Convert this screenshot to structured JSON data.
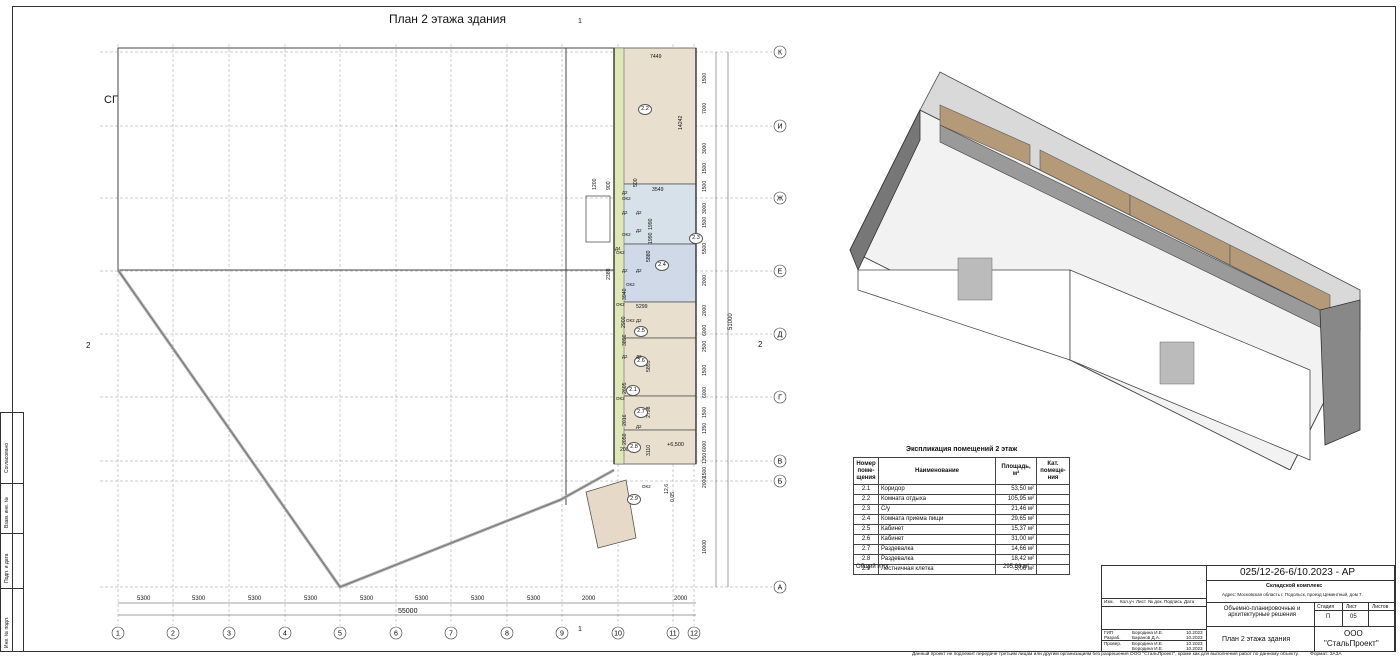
{
  "plan": {
    "title": "План 2 этажа здания",
    "section_marks": {
      "top": "1",
      "bottom": "1",
      "left": "2",
      "right": "2"
    },
    "axes_x": [
      "1",
      "2",
      "3",
      "4",
      "5",
      "6",
      "7",
      "8",
      "9",
      "10",
      "11",
      "12"
    ],
    "axes_y": [
      "К",
      "И",
      "Ж",
      "Е",
      "Д",
      "Г",
      "В",
      "Б",
      "А"
    ],
    "bottom_dims": [
      "5300",
      "5300",
      "5300",
      "5300",
      "5300",
      "5300",
      "5300",
      "5300",
      "2000",
      "2000"
    ],
    "overall_width": "55000",
    "overall_height": "51000",
    "right_dims": [
      "1500",
      "7000",
      "3000",
      "1500",
      "1500",
      "3000",
      "1500",
      "5500",
      "2000",
      "2000",
      "6000",
      "2500",
      "1500",
      "6000",
      "1500",
      "1350",
      "6000",
      "1350",
      "1500",
      "2000",
      "10000"
    ],
    "room_dims": [
      "7449",
      "14242",
      "3549",
      "5880",
      "5299",
      "2900",
      "5855",
      "2798",
      "3110",
      "2000",
      "3940",
      "3890",
      "2605",
      "2016",
      "2050",
      "2380",
      "900",
      "1200",
      "500",
      "1990",
      "1990",
      "12,6",
      "0,05"
    ],
    "room_tags": [
      "2.2",
      "2.3",
      "2.4",
      "2.5",
      "2.6",
      "2.1",
      "2.7",
      "2.8",
      "2.9"
    ],
    "door_tags": [
      "Д2",
      "Д2",
      "Д2",
      "Д2",
      "Д2",
      "Д2",
      "Д2",
      "Д2",
      "Д2",
      "Д2",
      "Д4",
      "ОК2",
      "ОК2",
      "ОК2",
      "ОК2",
      "ОК2",
      "ОК2",
      "ОК2",
      "ОК2"
    ],
    "level_mark": "+6,500",
    "stamp_label": "СГ"
  },
  "explication": {
    "title": "Экспликация помещений 2 этаж",
    "headers": [
      "Номер поме-щения",
      "Наименование",
      "Площадь, м²",
      "Кат. помеще-ния"
    ],
    "rows": [
      {
        "num": "2.1",
        "name": "Коридор",
        "area": "53,50 м²",
        "cat": ""
      },
      {
        "num": "2.2",
        "name": "Комната отдыха",
        "area": "105,95 м²",
        "cat": ""
      },
      {
        "num": "2.3",
        "name": "С/у",
        "area": "21,46 м²",
        "cat": ""
      },
      {
        "num": "2.4",
        "name": "Комната приема пищи",
        "area": "29,65 м²",
        "cat": ""
      },
      {
        "num": "2.5",
        "name": "Кабинет",
        "area": "15,37 м²",
        "cat": ""
      },
      {
        "num": "2.6",
        "name": "Кабинет",
        "area": "31,00 м²",
        "cat": ""
      },
      {
        "num": "2.7",
        "name": "Раздевалка",
        "area": "14,66 м²",
        "cat": ""
      },
      {
        "num": "2.8",
        "name": "Раздевалка",
        "area": "18,42 м²",
        "cat": ""
      },
      {
        "num": "2.9",
        "name": "Лестничная клетка",
        "area": "5,06 м²",
        "cat": ""
      }
    ],
    "total_label": "Общий итог",
    "total_value": "295,08 м²"
  },
  "title_block": {
    "code": "025/12-26-6/10.2023 - АР",
    "object": "Складской комплекс",
    "address": "Адрес: Московская область г. Подольск, проезд Цементный, дом 7.",
    "col_headers": [
      "Изм.",
      "Кол.уч",
      "Лист",
      "№ док.",
      "Подпись",
      "Дата"
    ],
    "section": "Объемно-планировочные и архитектурные решения",
    "stage_headers": [
      "Стадия",
      "Лист",
      "Листов"
    ],
    "stage_values": [
      "П",
      "05",
      ""
    ],
    "sheet_title": "План 2 этажа здания",
    "company_line1": "ООО",
    "company_line2": "\"СтальПроект\"",
    "roles": [
      {
        "role": "ГИП",
        "name": "Бородина И.Е.",
        "date": "10.2023"
      },
      {
        "role": "Разраб.",
        "name": "Баранов Д.А.",
        "date": "10.2023"
      },
      {
        "role": "Провер.",
        "name": "Бородина И.Е.",
        "date": "10.2023"
      },
      {
        "role": "",
        "name": "Бородина И.Е.",
        "date": "10.2023"
      }
    ]
  },
  "side_stamp": {
    "labels": [
      "Согласовано",
      "Взам. инв. №",
      "Подп. и дата",
      "Инв. № подл."
    ]
  },
  "footer": {
    "note": "Данный проект не подлежит передаче третьим лицам или другим организациям без разрешения ООО \"СтальПроект\", кроме как для выполнения работ по данному объекту.",
    "format": "Формат: 3А3А"
  }
}
